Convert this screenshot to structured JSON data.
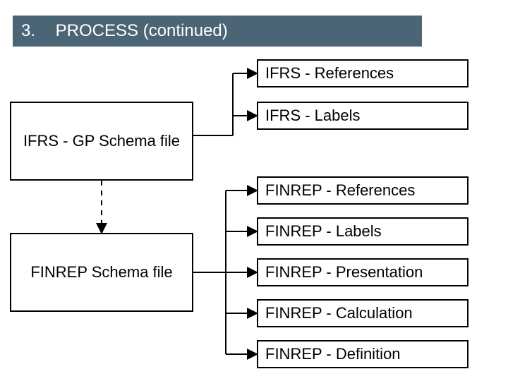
{
  "header": {
    "number": "3.",
    "title": "PROCESS (continued)"
  },
  "left": {
    "ifrs_gp": "IFRS - GP Schema file",
    "finrep": "FINREP Schema file"
  },
  "right": {
    "ifrs_refs": "IFRS - References",
    "ifrs_labels": "IFRS - Labels",
    "finrep_refs": "FINREP - References",
    "finrep_labels": "FINREP - Labels",
    "finrep_pres": "FINREP - Presentation",
    "finrep_calc": "FINREP - Calculation",
    "finrep_def": "FINREP - Definition"
  }
}
